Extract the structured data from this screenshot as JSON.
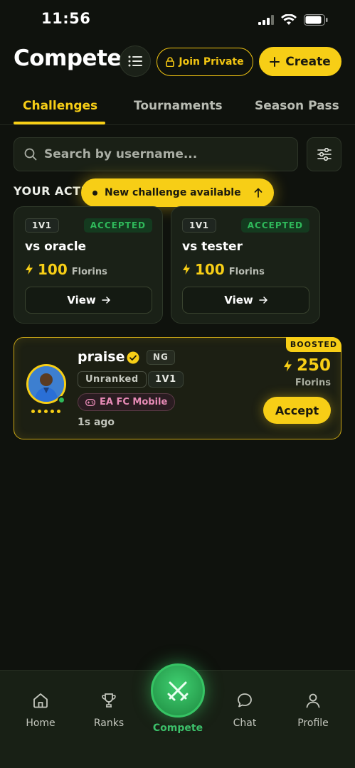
{
  "status_bar": {
    "time": "11:56"
  },
  "header": {
    "title": "Compete",
    "join_private_label": "Join Private",
    "create_label": "Create"
  },
  "tabs": [
    {
      "label": "Challenges",
      "active": true
    },
    {
      "label": "Tournaments",
      "active": false
    },
    {
      "label": "Season Pass",
      "active": false
    }
  ],
  "search": {
    "placeholder": "Search by username..."
  },
  "section_title": "YOUR ACTIVE",
  "toast": {
    "label": "New challenge available"
  },
  "active_challenges": [
    {
      "type": "1V1",
      "status": "ACCEPTED",
      "opponent": "vs oracle",
      "amount": "100",
      "currency": "Florins",
      "view_label": "View"
    },
    {
      "type": "1V1",
      "status": "ACCEPTED",
      "opponent": "vs tester",
      "amount": "100",
      "currency": "Florins",
      "view_label": "View"
    }
  ],
  "boosted_challenge": {
    "tag": "BOOSTED",
    "username": "praise",
    "country": "NG",
    "rank": "Unranked",
    "type": "1V1",
    "game": "EA FC Mobile",
    "time_ago": "1s ago",
    "amount": "250",
    "currency": "Florins",
    "accept_label": "Accept",
    "rank_dots": 5
  },
  "bottom_nav": {
    "items": [
      {
        "label": "Home",
        "icon": "home-icon"
      },
      {
        "label": "Ranks",
        "icon": "trophy-icon"
      },
      {
        "label": "Compete",
        "icon": "crossed-swords-icon",
        "active": true
      },
      {
        "label": "Chat",
        "icon": "chat-icon"
      },
      {
        "label": "Profile",
        "icon": "profile-icon"
      }
    ]
  },
  "colors": {
    "accent": "#f7ce16",
    "active_nav": "#3cc06a",
    "accepted": "#2fb95a",
    "background": "#0f120d"
  }
}
